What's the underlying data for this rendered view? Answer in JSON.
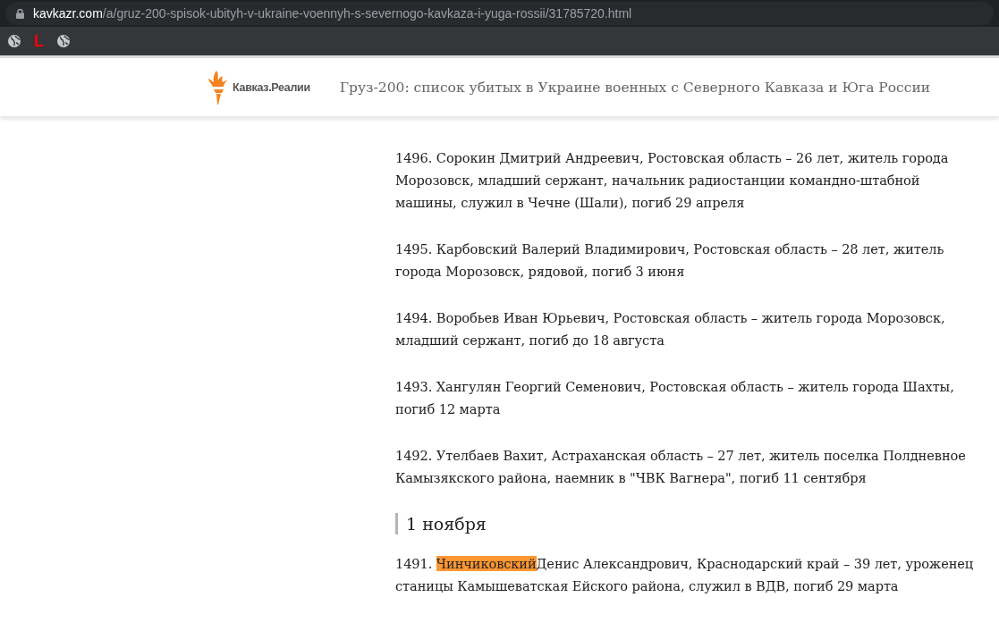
{
  "browser": {
    "address": {
      "domain": "kavkazr.com",
      "path": "/a/gruz-200-spisok-ubityh-v-ukraine-voennyh-s-severnogo-kavkaza-i-yuga-rossii/31785720.html"
    },
    "bookmarks": [
      {
        "kind": "globe"
      },
      {
        "kind": "letter",
        "text": "L"
      },
      {
        "kind": "globe"
      }
    ]
  },
  "header": {
    "logo": "Кавказ.Реалии",
    "title": "Груз-200: список убитых в Украине военных с Северного Кавказа и Юга России"
  },
  "article": [
    {
      "kind": "entry",
      "parts": [
        {
          "text": "1496. Сорокин Дмитрий Андреевич, Ростовская область – 26 лет, житель города Морозовск, младший сержант, начальник радиостанции командно-штабной машины, служил в Чечне (Шали), погиб 29 апреля",
          "highlighted": false
        }
      ]
    },
    {
      "kind": "entry",
      "parts": [
        {
          "text": "1495. Карбовский Валерий Владимирович, Ростовская область – 28 лет, житель города Морозовск, рядовой, погиб 3 июня",
          "highlighted": false
        }
      ]
    },
    {
      "kind": "entry",
      "parts": [
        {
          "text": "1494. Воробьев Иван Юрьевич, Ростовская область – житель города Морозовск, младший сержант, погиб до 18 августа",
          "highlighted": false
        }
      ]
    },
    {
      "kind": "entry",
      "parts": [
        {
          "text": "1493. Хангулян Георгий Семенович, Ростовская область – житель города Шахты, погиб 12 марта",
          "highlighted": false
        }
      ]
    },
    {
      "kind": "entry",
      "parts": [
        {
          "text": "1492. Утелбаев Вахит, Астраханская область – 27 лет, житель поселка Полдневное Камызякского района, наемник в \"ЧВК Вагнера\", погиб 11 сентября",
          "highlighted": false
        }
      ]
    },
    {
      "kind": "date",
      "text": "1 ноября"
    },
    {
      "kind": "entry",
      "parts": [
        {
          "text": "1491. ",
          "highlighted": false
        },
        {
          "text": "Чинчиковский",
          "highlighted": true
        },
        {
          "text": "Денис Александрович, Краснодарский край – 39 лет, уроженец станицы Камышеватская Ейского района, служил в ВДВ, погиб 29 марта",
          "highlighted": false
        }
      ]
    }
  ]
}
